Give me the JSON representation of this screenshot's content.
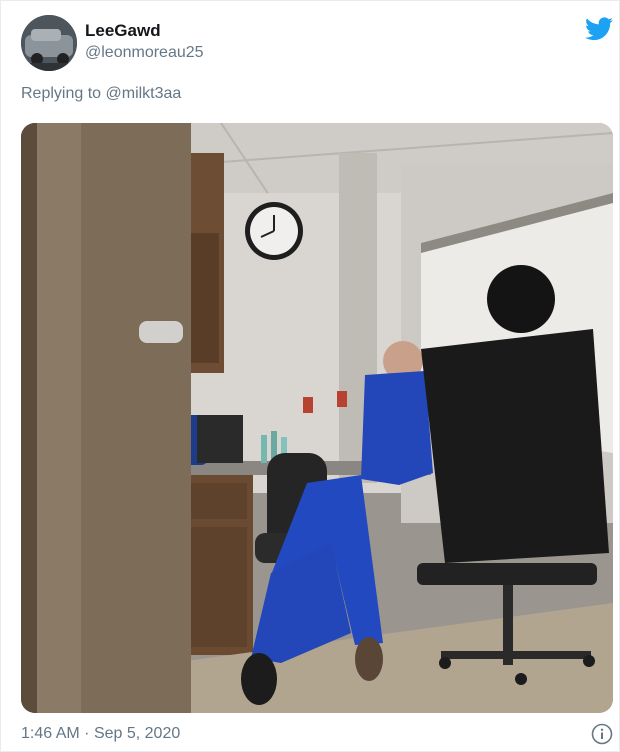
{
  "tweet": {
    "display_name": "LeeGawd",
    "handle": "@leonmoreau25",
    "replying_prefix": "Replying to",
    "replying_to": "@milkt3aa",
    "time": "1:46 AM",
    "separator": "·",
    "date": "Sep 5, 2020"
  },
  "icons": {
    "brand": "twitter-bird-icon",
    "info": "info-icon"
  },
  "colors": {
    "twitter_blue": "#1da1f2",
    "secondary_text": "#657786",
    "primary_text": "#14171a"
  }
}
